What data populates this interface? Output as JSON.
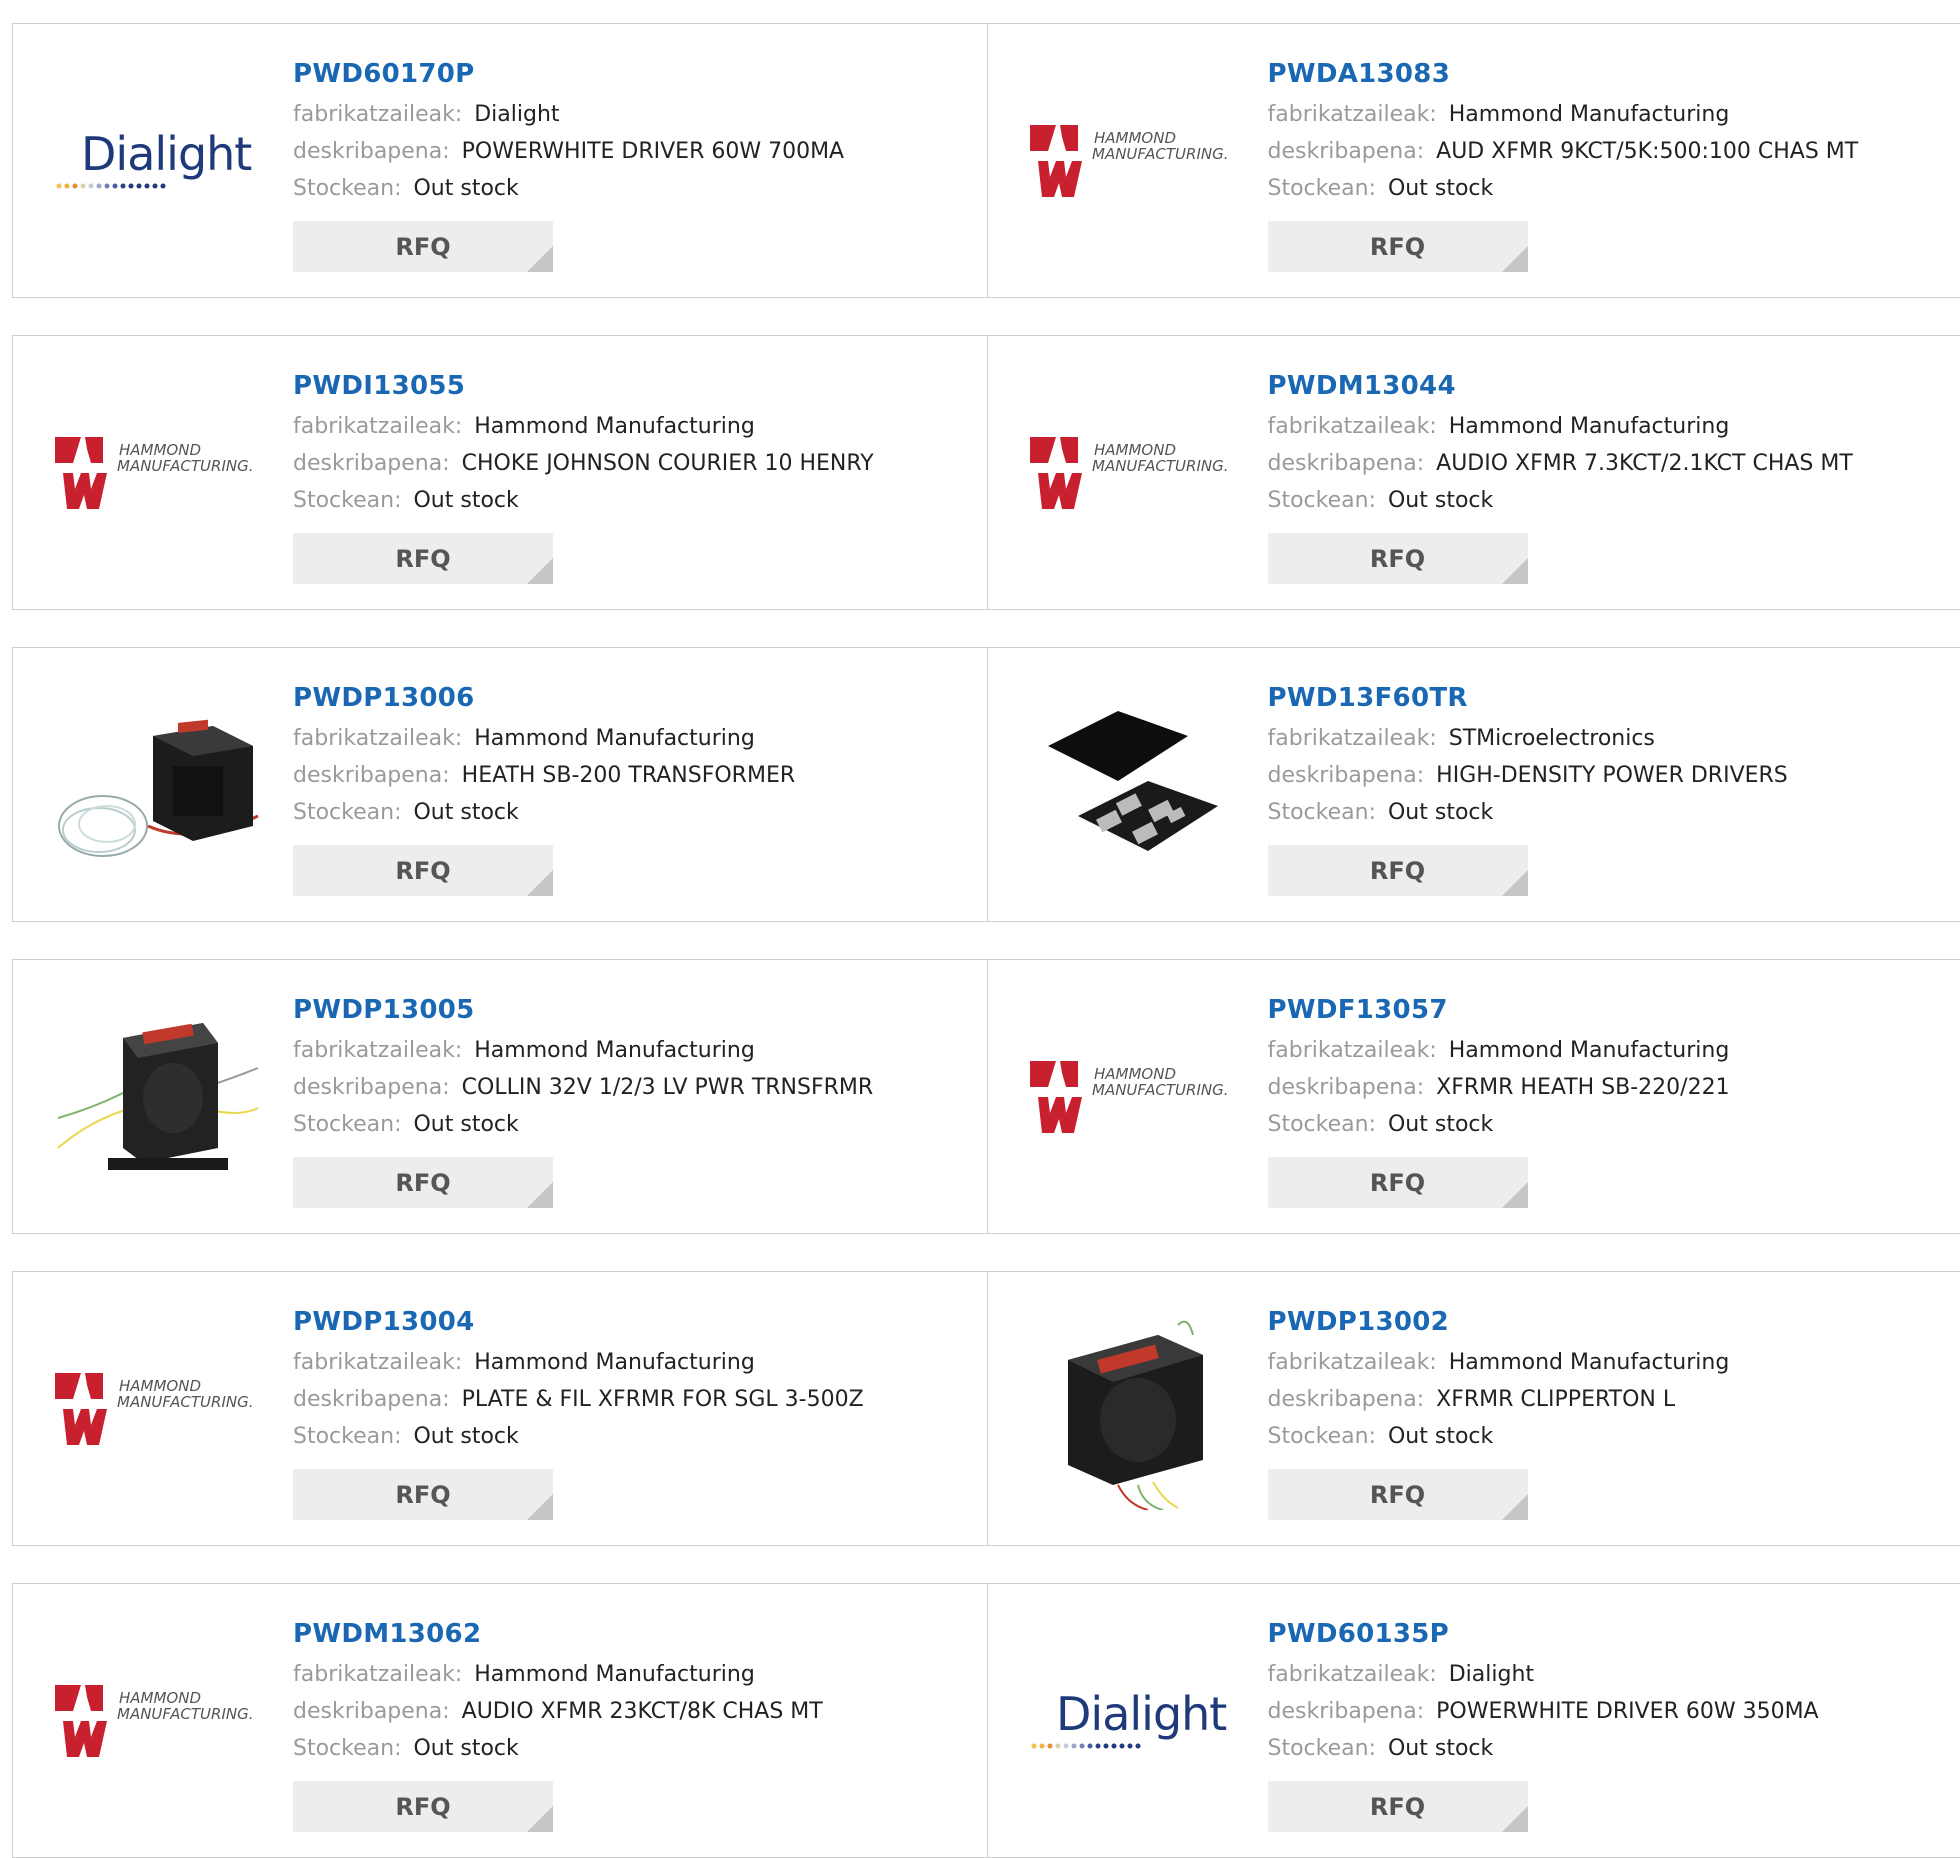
{
  "labels": {
    "manufacturer": "fabrikatzaileak:",
    "description": "deskribapena:",
    "stock": "Stockean:",
    "rfq": "RFQ"
  },
  "colors": {
    "part_link": "#1a68b3",
    "label_gray": "#9a9a9a",
    "rfq_bg": "#ededed",
    "hammond_red": "#c8202f",
    "dialight_blue": "#1f3a7a"
  },
  "products": [
    {
      "part": "PWD60170P",
      "manufacturer": "Dialight",
      "description": "POWERWHITE DRIVER 60W 700MA",
      "stock": "Out stock",
      "image": "dialight-logo"
    },
    {
      "part": "PWDA13083",
      "manufacturer": "Hammond Manufacturing",
      "description": "AUD XFMR 9KCT/5K:500:100 CHAS MT",
      "stock": "Out stock",
      "image": "hammond-logo"
    },
    {
      "part": "PWDI13055",
      "manufacturer": "Hammond Manufacturing",
      "description": "CHOKE JOHNSON COURIER 10 HENRY",
      "stock": "Out stock",
      "image": "hammond-logo"
    },
    {
      "part": "PWDM13044",
      "manufacturer": "Hammond Manufacturing",
      "description": "AUDIO XFMR 7.3KCT/2.1KCT CHAS MT",
      "stock": "Out stock",
      "image": "hammond-logo"
    },
    {
      "part": "PWDP13006",
      "manufacturer": "Hammond Manufacturing",
      "description": "HEATH SB-200 TRANSFORMER",
      "stock": "Out stock",
      "image": "transformer-wires-photo"
    },
    {
      "part": "PWD13F60TR",
      "manufacturer": "STMicroelectronics",
      "description": "HIGH-DENSITY POWER DRIVERS",
      "stock": "Out stock",
      "image": "chip-package-photo"
    },
    {
      "part": "PWDP13005",
      "manufacturer": "Hammond Manufacturing",
      "description": "COLLIN 32V 1/2/3 LV PWR TRNSFRMR",
      "stock": "Out stock",
      "image": "transformer-open-photo"
    },
    {
      "part": "PWDF13057",
      "manufacturer": "Hammond Manufacturing",
      "description": "XFRMR HEATH SB-220/221",
      "stock": "Out stock",
      "image": "hammond-logo"
    },
    {
      "part": "PWDP13004",
      "manufacturer": "Hammond Manufacturing",
      "description": "PLATE & FIL XFRMR FOR SGL 3-500Z",
      "stock": "Out stock",
      "image": "hammond-logo"
    },
    {
      "part": "PWDP13002",
      "manufacturer": "Hammond Manufacturing",
      "description": "XFRMR CLIPPERTON L",
      "stock": "Out stock",
      "image": "transformer-box-photo"
    },
    {
      "part": "PWDM13062",
      "manufacturer": "Hammond Manufacturing",
      "description": "AUDIO XFMR 23KCT/8K CHAS MT",
      "stock": "Out stock",
      "image": "hammond-logo"
    },
    {
      "part": "PWD60135P",
      "manufacturer": "Dialight",
      "description": "POWERWHITE DRIVER 60W 350MA",
      "stock": "Out stock",
      "image": "dialight-logo"
    }
  ]
}
